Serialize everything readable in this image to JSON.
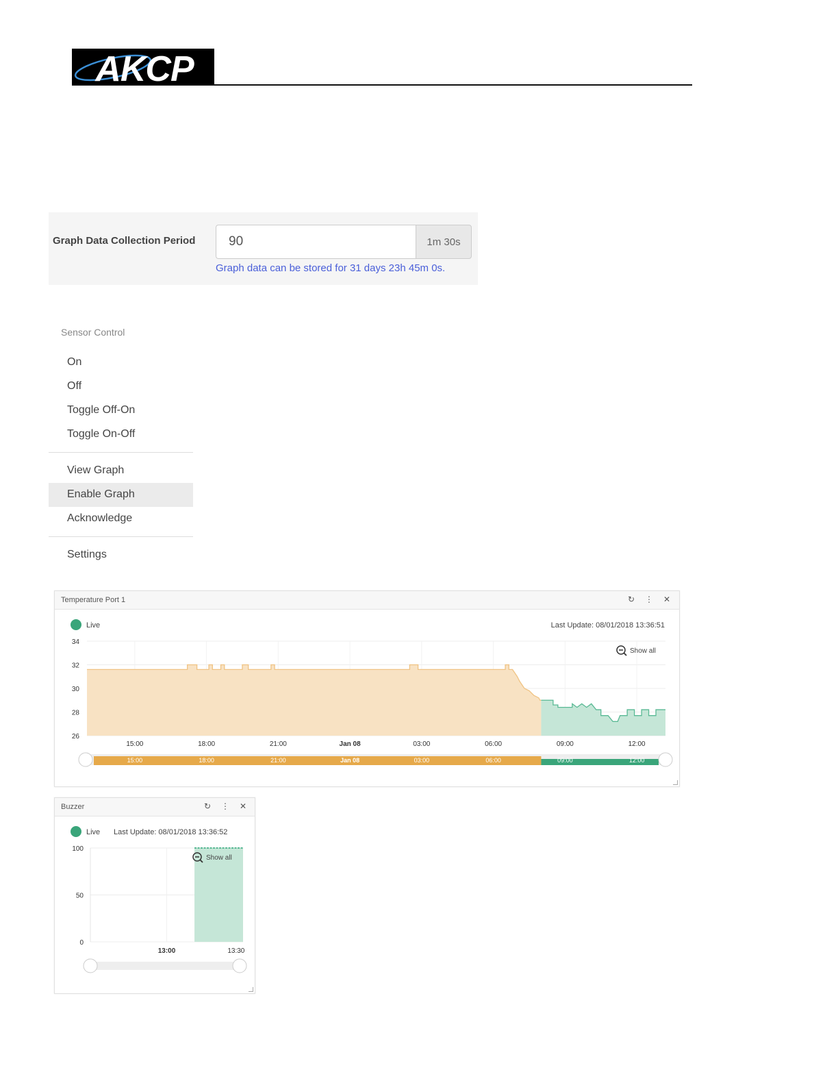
{
  "header": {
    "logo_text": "AKCP"
  },
  "period": {
    "label": "Graph Data Collection Period",
    "value": "90",
    "addon": "1m 30s",
    "help": "Graph data can be stored for 31 days 23h 45m 0s."
  },
  "menu": {
    "header": "Sensor Control",
    "items": [
      "On",
      "Off",
      "Toggle Off-On",
      "Toggle On-Off",
      "View Graph",
      "Enable Graph",
      "Acknowledge",
      "Settings"
    ],
    "active": "Enable Graph"
  },
  "colors": {
    "orange": "#f0c383",
    "orange_fill": "#f8e2c3",
    "green": "#59b994",
    "green_fill": "#c5e6d7",
    "live": "#3aa57a"
  },
  "temp_widget": {
    "title": "Temperature Port 1",
    "live_label": "Live",
    "last_update": "Last Update: 08/01/2018 13:36:51",
    "show_all": "Show all",
    "icons": [
      "refresh-icon",
      "more-vertical-icon",
      "close-icon"
    ]
  },
  "buzzer_widget": {
    "title": "Buzzer",
    "live_label": "Live",
    "last_update": "Last Update: 08/01/2018 13:36:52",
    "show_all": "Show all",
    "icons": [
      "refresh-icon",
      "more-vertical-icon",
      "close-icon"
    ]
  },
  "chart_data": [
    {
      "type": "area",
      "title": "Temperature Port 1",
      "ylim": [
        26,
        34
      ],
      "yticks": [
        34,
        32,
        30,
        28,
        26
      ],
      "xticks": [
        "15:00",
        "18:00",
        "21:00",
        "Jan 08",
        "03:00",
        "06:00",
        "09:00",
        "12:00"
      ],
      "xticks_bold": [
        "Jan 08"
      ],
      "x_hours": [
        13,
        37.2
      ],
      "series": [
        {
          "color": "orange",
          "points": [
            [
              13.0,
              31.6
            ],
            [
              17.2,
              31.6
            ],
            [
              17.2,
              32.0
            ],
            [
              17.6,
              32.0
            ],
            [
              17.6,
              31.6
            ],
            [
              18.1,
              31.6
            ],
            [
              18.1,
              32.0
            ],
            [
              18.25,
              32.0
            ],
            [
              18.25,
              31.6
            ],
            [
              18.6,
              31.6
            ],
            [
              18.6,
              32.0
            ],
            [
              18.75,
              32.0
            ],
            [
              18.75,
              31.6
            ],
            [
              19.5,
              31.6
            ],
            [
              19.5,
              32.0
            ],
            [
              19.75,
              32.0
            ],
            [
              19.75,
              31.6
            ],
            [
              20.7,
              31.6
            ],
            [
              20.7,
              32.0
            ],
            [
              20.85,
              32.0
            ],
            [
              20.85,
              31.6
            ],
            [
              26.5,
              31.6
            ],
            [
              26.5,
              32.0
            ],
            [
              26.85,
              32.0
            ],
            [
              26.85,
              31.6
            ],
            [
              30.5,
              31.6
            ],
            [
              30.5,
              32.0
            ],
            [
              30.65,
              32.0
            ],
            [
              30.65,
              31.6
            ],
            [
              30.8,
              31.6
            ],
            [
              31.0,
              31.0
            ],
            [
              31.1,
              30.6
            ],
            [
              31.3,
              30.0
            ],
            [
              31.5,
              29.8
            ],
            [
              31.7,
              29.4
            ],
            [
              31.9,
              29.2
            ],
            [
              31.95,
              29.0
            ],
            [
              32.0,
              29.0
            ]
          ]
        },
        {
          "color": "green",
          "points": [
            [
              32.0,
              29.0
            ],
            [
              32.5,
              29.0
            ],
            [
              32.5,
              28.6
            ],
            [
              32.7,
              28.6
            ],
            [
              32.7,
              28.4
            ],
            [
              33.3,
              28.4
            ],
            [
              33.3,
              28.7
            ],
            [
              33.5,
              28.4
            ],
            [
              33.7,
              28.7
            ],
            [
              33.9,
              28.4
            ],
            [
              34.1,
              28.7
            ],
            [
              34.3,
              28.2
            ],
            [
              34.5,
              28.2
            ],
            [
              34.5,
              27.7
            ],
            [
              34.8,
              27.7
            ],
            [
              35.0,
              27.2
            ],
            [
              35.2,
              27.2
            ],
            [
              35.3,
              27.7
            ],
            [
              35.6,
              27.7
            ],
            [
              35.6,
              28.2
            ],
            [
              35.9,
              28.2
            ],
            [
              35.9,
              27.7
            ],
            [
              36.2,
              27.7
            ],
            [
              36.2,
              28.2
            ],
            [
              36.5,
              28.2
            ],
            [
              36.5,
              27.7
            ],
            [
              36.8,
              27.7
            ],
            [
              36.8,
              28.2
            ],
            [
              37.0,
              28.2
            ],
            [
              37.2,
              28.2
            ]
          ]
        }
      ]
    },
    {
      "type": "area",
      "title": "Buzzer",
      "ylim": [
        0,
        100
      ],
      "yticks": [
        100,
        50,
        0
      ],
      "xticks": [
        "13:00",
        "13:30"
      ],
      "xticks_bold": [
        "13:00"
      ],
      "x_minutes": [
        12.45,
        13.55
      ],
      "series": [
        {
          "color": "green",
          "start": 13.2,
          "end": 13.55,
          "value": 100
        }
      ]
    }
  ]
}
